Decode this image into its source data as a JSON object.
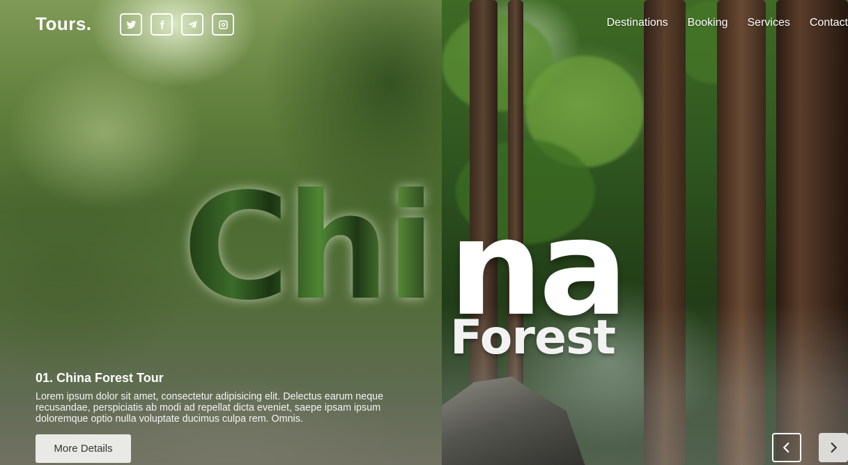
{
  "header": {
    "logo": "Tours.",
    "socials": [
      {
        "icon": "twitter-icon"
      },
      {
        "icon": "facebook-icon"
      },
      {
        "icon": "telegram-icon"
      },
      {
        "icon": "instagram-icon"
      }
    ],
    "nav": [
      "Destinations",
      "Booking",
      "Services",
      "Contact"
    ]
  },
  "hero": {
    "title_part1": "Chi",
    "title_part2": "na",
    "subtitle": "Forest"
  },
  "tour": {
    "heading": "01. China Forest Tour",
    "description": "Lorem ipsum dolor sit amet, consectetur adipisicing elit. Delectus earum neque recusandae, perspiciatis ab modi ad repellat dicta eveniet, saepe ipsam ipsum doloremque optio nulla voluptate ducimus culpa rem. Omnis.",
    "button_label": "More Details"
  },
  "slider": {
    "prev_icon": "chevron-left-icon",
    "next_icon": "chevron-right-icon"
  }
}
